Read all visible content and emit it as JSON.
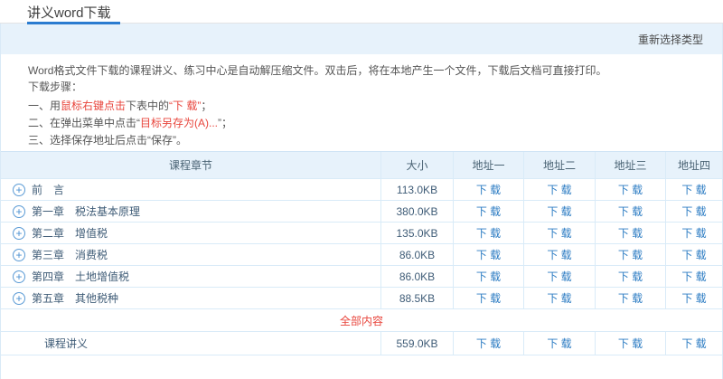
{
  "page": {
    "title": "讲义word下载",
    "reselect_link": "重新选择类型"
  },
  "instructions": {
    "intro": "Word格式文件下载的课程讲义、练习中心是自动解压缩文件。双击后，将在本地产生一个文件，下载后文档可直接打印。",
    "steps_title": "下载步骤：",
    "step1_prefix": "一、用",
    "step1_red1": "鼠标右键点击",
    "step1_mid": "下表中的",
    "step1_red2": "“下 载”",
    "step1_suffix": "；",
    "step2_prefix": "二、在弹出菜单中点击“",
    "step2_red": "目标另存为(A)...",
    "step2_suffix": "”；",
    "step3": "三、选择保存地址后点击“保存”。"
  },
  "table": {
    "headers": [
      "课程章节",
      "大小",
      "地址一",
      "地址二",
      "地址三",
      "地址四"
    ],
    "download_label": "下 载",
    "rows": [
      {
        "chapter": "前　言",
        "size": "113.0KB"
      },
      {
        "chapter": "第一章　税法基本原理",
        "size": "380.0KB"
      },
      {
        "chapter": "第二章　增值税",
        "size": "135.0KB"
      },
      {
        "chapter": "第三章　消费税",
        "size": "86.0KB"
      },
      {
        "chapter": "第四章　土地增值税",
        "size": "86.0KB"
      },
      {
        "chapter": "第五章　其他税种",
        "size": "88.5KB"
      }
    ],
    "section_label": "全部内容",
    "full_row": {
      "chapter": "课程讲义",
      "size": "559.0KB"
    }
  },
  "colors": {
    "accent_blue": "#2b7cd0",
    "link_blue": "#2c7cc3",
    "band_bg": "#e7f2fb",
    "border_blue": "#d9ebf8",
    "text_dark_blue": "#3f5c77",
    "alert_red": "#e8453c"
  }
}
